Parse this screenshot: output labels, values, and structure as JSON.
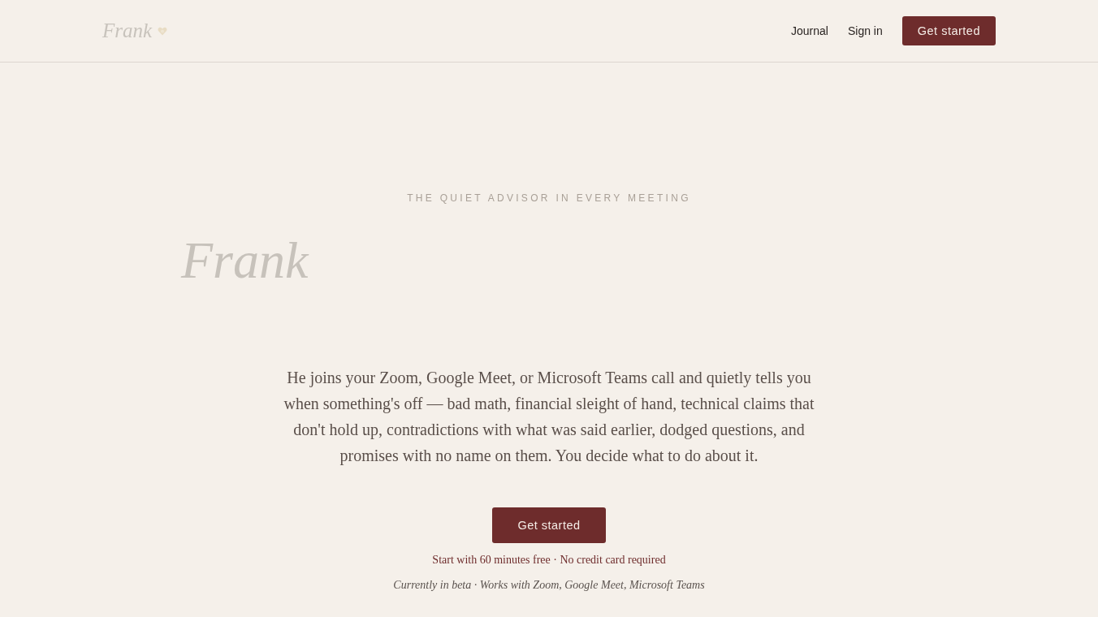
{
  "header": {
    "logo": "Frank",
    "nav": [
      {
        "label": "Journal"
      },
      {
        "label": "Sign in"
      }
    ],
    "cta": "Get started"
  },
  "hero": {
    "eyebrow": "THE QUIET ADVISOR IN EVERY MEETING",
    "title": "Frank",
    "description": "He joins your Zoom, Google Meet, or Microsoft Teams call and quietly tells you when something's off — bad math, financial sleight of hand, technical claims that don't hold up, contradictions with what was said earlier, dodged questions, and promises with no name on them. You decide what to do about it.",
    "cta": "Get started",
    "note": "Start with 60 minutes free · No credit card required",
    "footnote": "Currently in beta · Works with Zoom, Google Meet, Microsoft Teams"
  }
}
